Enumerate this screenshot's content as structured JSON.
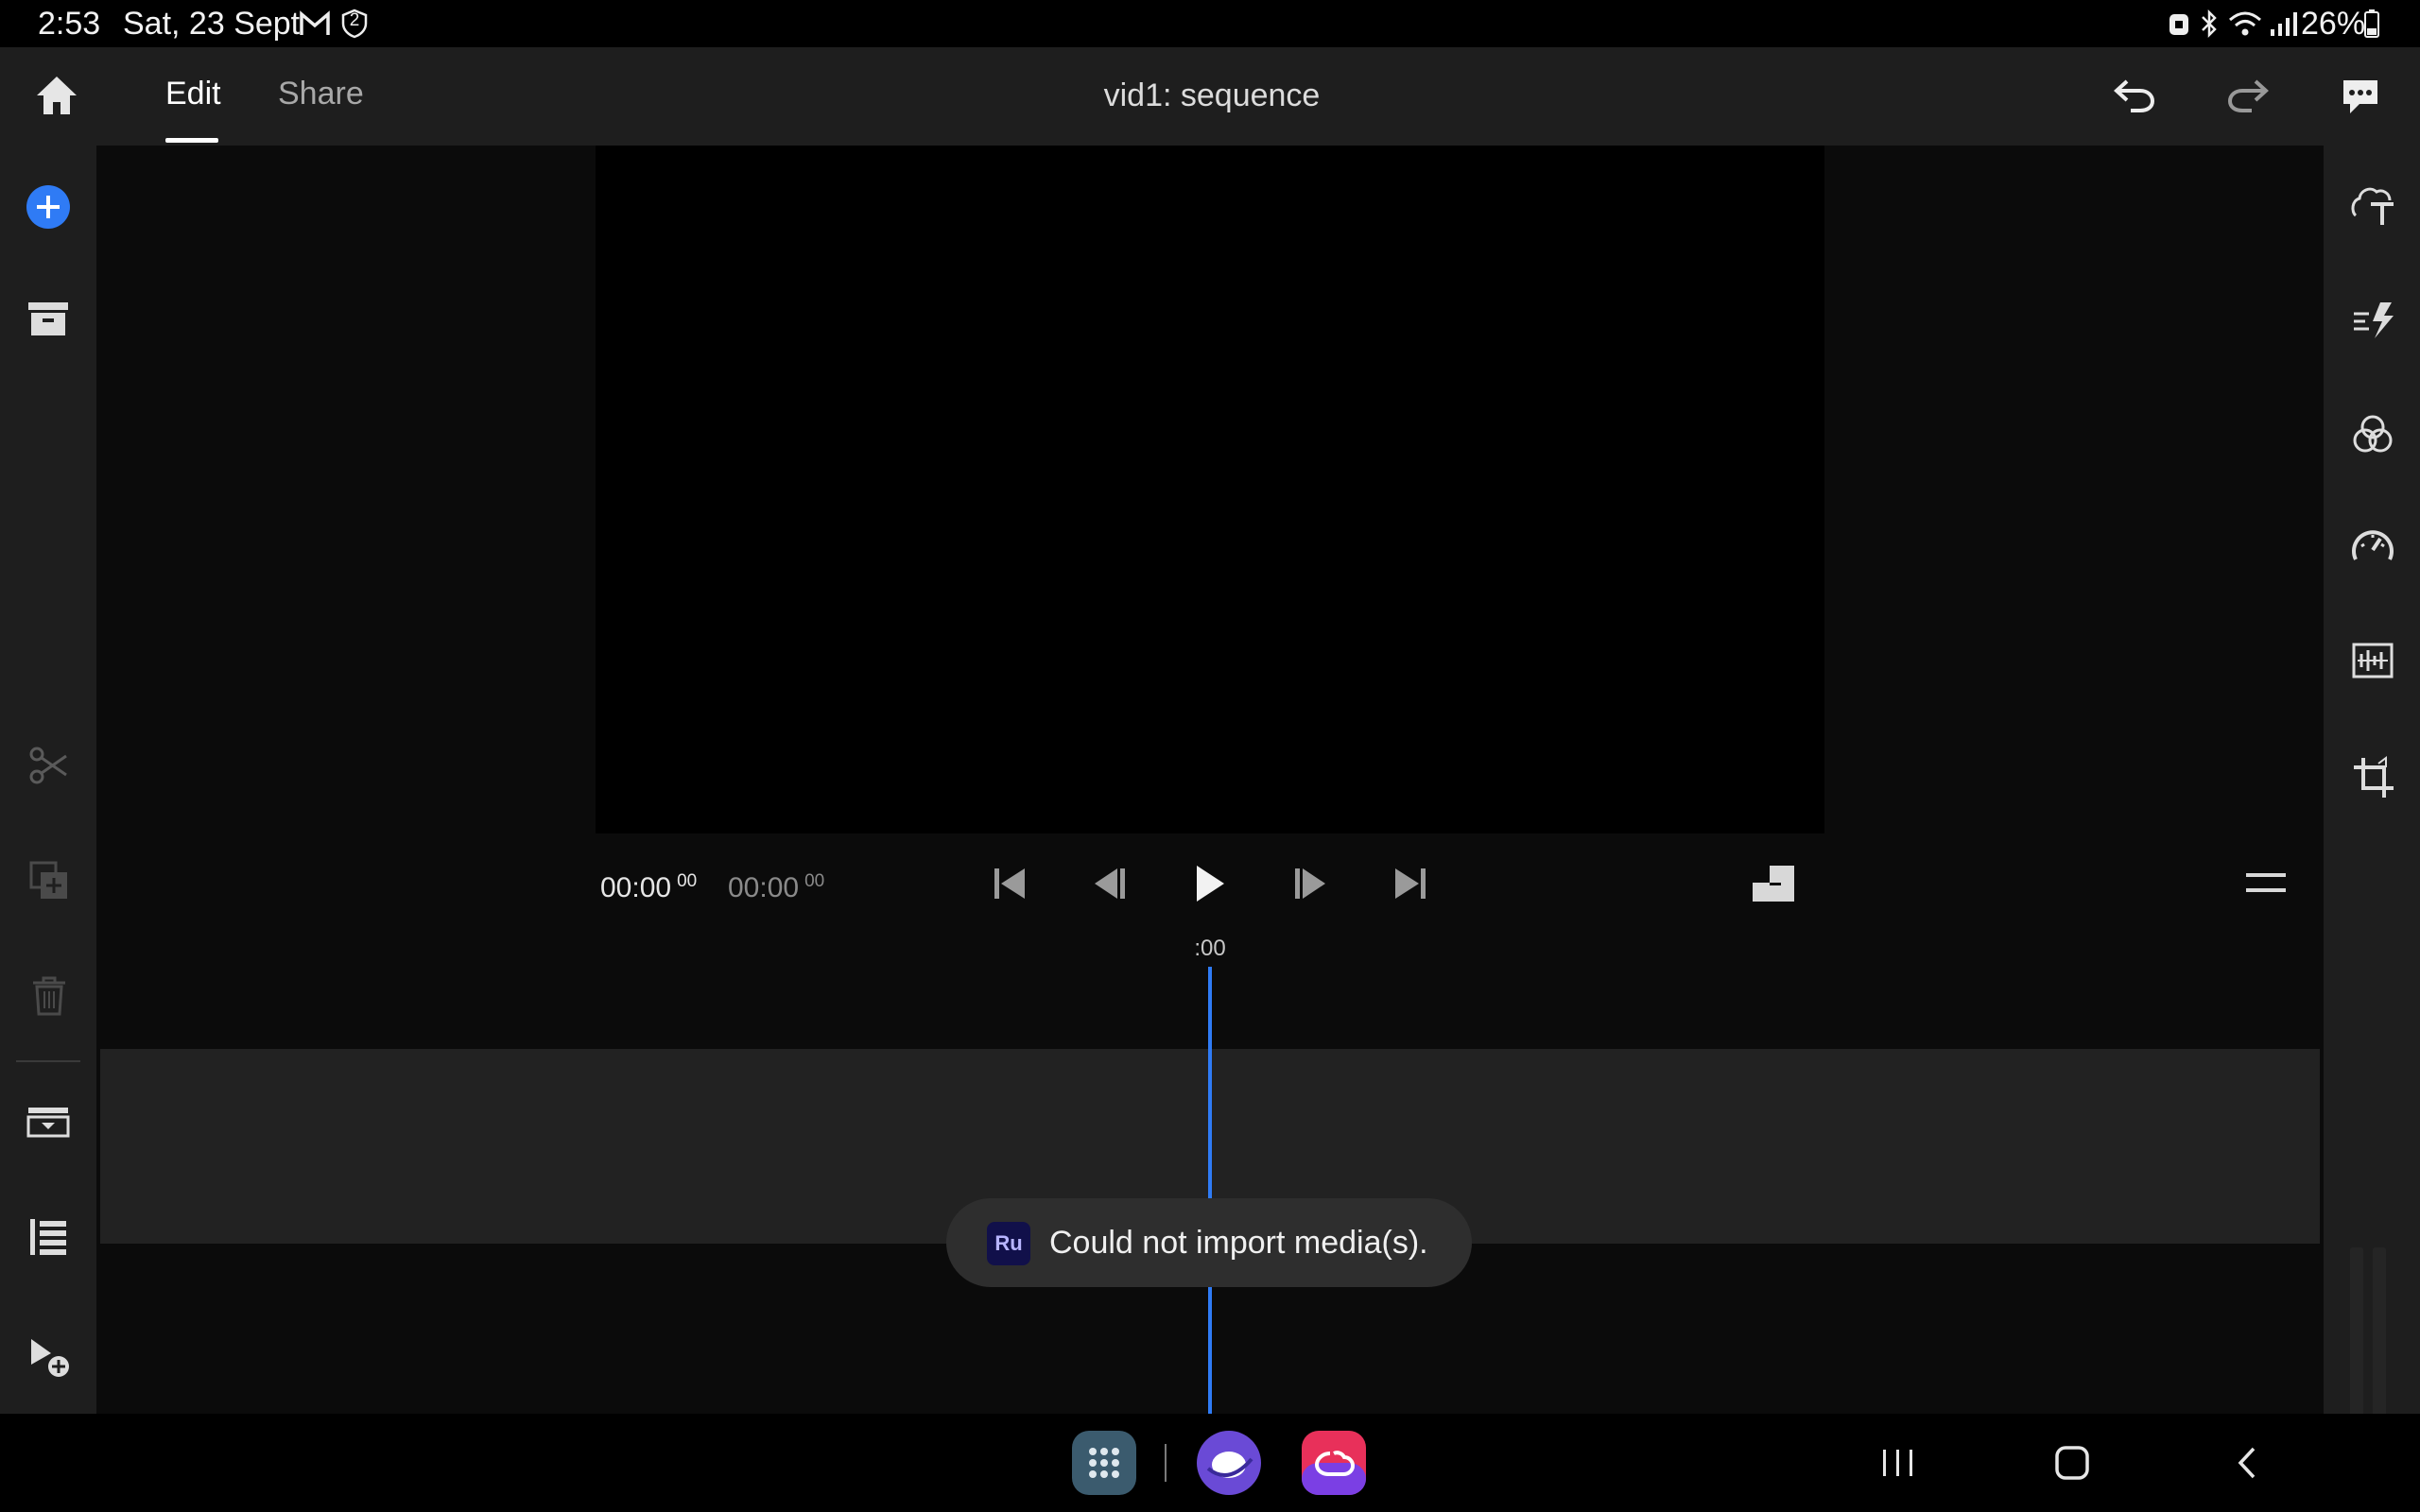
{
  "status_bar": {
    "time": "2:53",
    "date": "Sat, 23 Sept",
    "notification_badge": "2",
    "battery": "26%"
  },
  "header": {
    "tabs": [
      {
        "label": "Edit",
        "active": true
      },
      {
        "label": "Share",
        "active": false
      }
    ],
    "title": "vid1: sequence"
  },
  "player": {
    "current_time": "00:00",
    "current_frames": "00",
    "duration_time": "00:00",
    "duration_frames": "00"
  },
  "timeline": {
    "ruler_label": ":00"
  },
  "toast": {
    "app_badge": "Ru",
    "message": "Could not import media(s)."
  },
  "colors": {
    "accent": "#2f7bf5",
    "panel": "#1e1e1e",
    "background": "#0b0b0b"
  },
  "icons": {
    "left_bar": [
      "add-media-icon",
      "archive-icon",
      "scissors-icon",
      "duplicate-icon",
      "trash-icon",
      "track-collapse-icon",
      "track-list-icon",
      "select-add-icon"
    ],
    "right_bar": [
      "title-text-icon",
      "transitions-icon",
      "color-icon",
      "speed-icon",
      "audio-icon",
      "crop-icon"
    ]
  }
}
